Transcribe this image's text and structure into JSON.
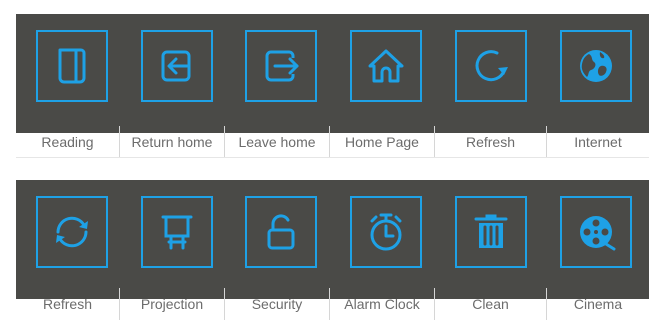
{
  "accent_color": "#1ea1e6",
  "panel_color": "#4a4a47",
  "rows": [
    {
      "items": [
        {
          "label": "Reading",
          "icon": "book-icon"
        },
        {
          "label": "Return home",
          "icon": "return-home-icon"
        },
        {
          "label": "Leave home",
          "icon": "leave-home-icon"
        },
        {
          "label": "Home Page",
          "icon": "home-icon"
        },
        {
          "label": "Refresh",
          "icon": "refresh-icon"
        },
        {
          "label": "Internet",
          "icon": "globe-icon"
        }
      ]
    },
    {
      "items": [
        {
          "label": "Refresh",
          "icon": "refresh-arrows-icon"
        },
        {
          "label": "Projection",
          "icon": "projector-screen-icon"
        },
        {
          "label": "Security",
          "icon": "unlocked-padlock-icon"
        },
        {
          "label": "Alarm Clock",
          "icon": "stopwatch-icon"
        },
        {
          "label": "Clean",
          "icon": "trash-bin-icon"
        },
        {
          "label": "Cinema",
          "icon": "film-reel-icon"
        }
      ]
    }
  ]
}
